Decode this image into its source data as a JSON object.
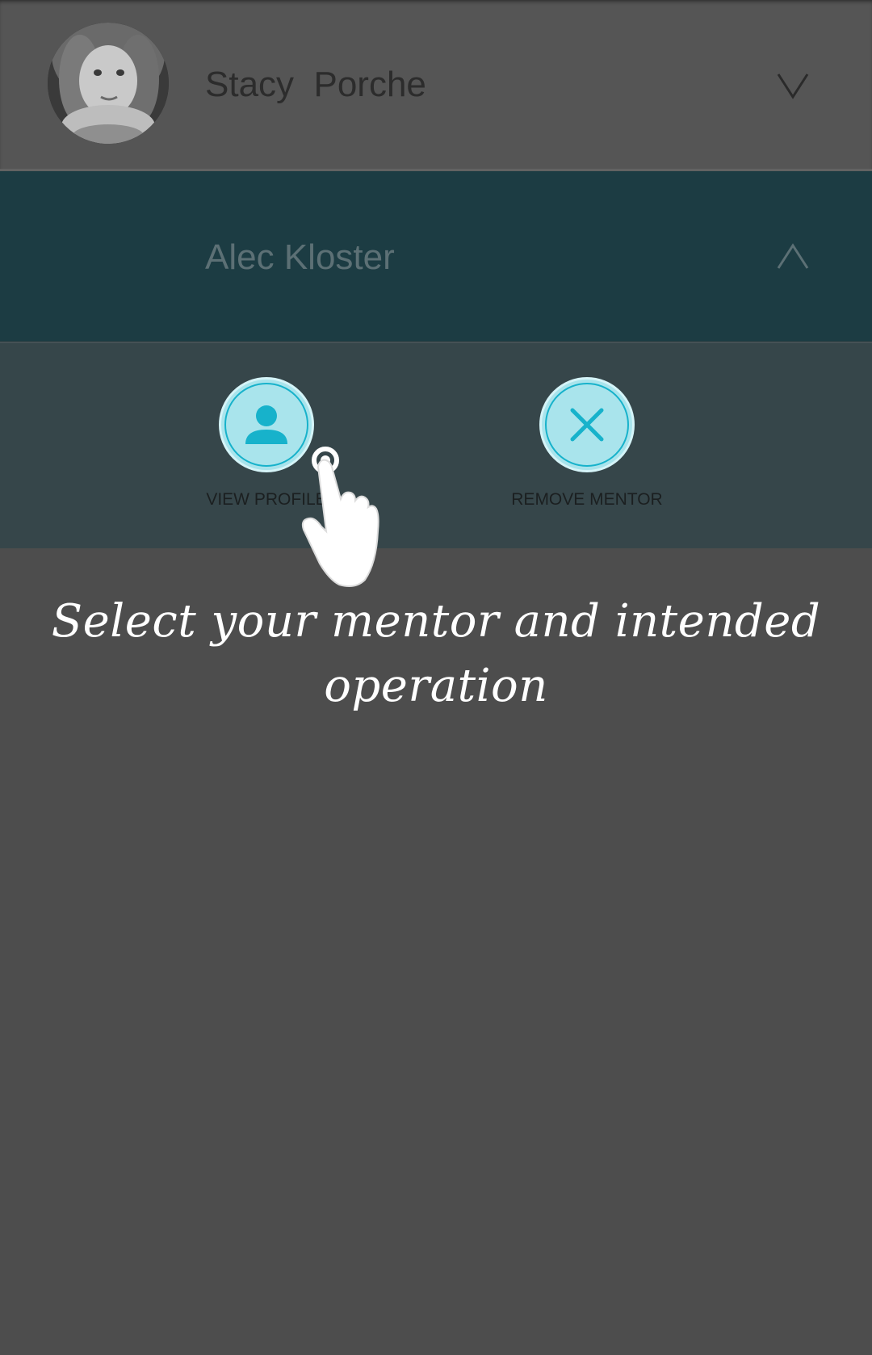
{
  "mentors": [
    {
      "name": "Stacy  Porche",
      "expanded": false,
      "toggle_icon": "chevron-down-icon"
    },
    {
      "name": "Alec Kloster",
      "expanded": true,
      "toggle_icon": "chevron-up-icon"
    }
  ],
  "actions": {
    "view_profile": {
      "label": "VIEW PROFILE",
      "icon": "person-icon"
    },
    "remove_mentor": {
      "label": "REMOVE MENTOR",
      "icon": "close-icon"
    }
  },
  "tutorial": {
    "tip": "Select your mentor and intended operation",
    "gesture_icon": "tap-hand-icon"
  },
  "colors": {
    "overlay_background": "#4d4d4d",
    "selected_row": "#1c3c43",
    "action_panel": "#36464a",
    "accent": "#17b2cb",
    "button_fill": "#a9e4ec"
  }
}
